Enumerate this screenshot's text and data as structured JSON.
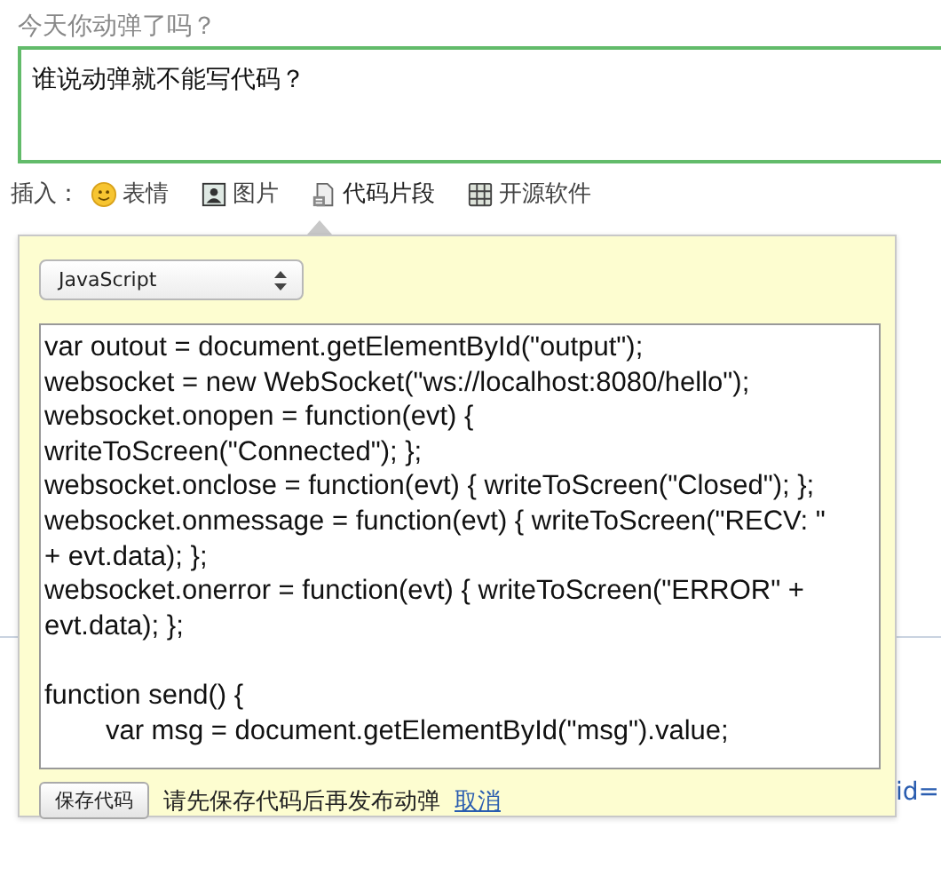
{
  "prompt": "今天你动弹了吗？",
  "post": {
    "value": "谁说动弹就不能写代码？"
  },
  "insert_bar": {
    "label": "插入：",
    "items": [
      {
        "kind": "emoji",
        "label": "表情"
      },
      {
        "kind": "image",
        "label": "图片"
      },
      {
        "kind": "code",
        "label": "代码片段",
        "selected": true
      },
      {
        "kind": "software",
        "label": "开源软件"
      }
    ]
  },
  "code_popup": {
    "language": "JavaScript",
    "code": "var outout = document.getElementById(\"output\");\nwebsocket = new WebSocket(\"ws://localhost:8080/hello\");\nwebsocket.onopen = function(evt) {\nwriteToScreen(\"Connected\"); };\nwebsocket.onclose = function(evt) { writeToScreen(\"Closed\"); };\nwebsocket.onmessage = function(evt) { writeToScreen(\"RECV: \"\n+ evt.data); };\nwebsocket.onerror = function(evt) { writeToScreen(\"ERROR\" +\nevt.data); };\n\nfunction send() {\n        var msg = document.getElementById(\"msg\").value;",
    "save_button": "保存代码",
    "hint": "请先保存代码后再发布动弹",
    "cancel_link": "取消"
  },
  "background_fragment": "id="
}
